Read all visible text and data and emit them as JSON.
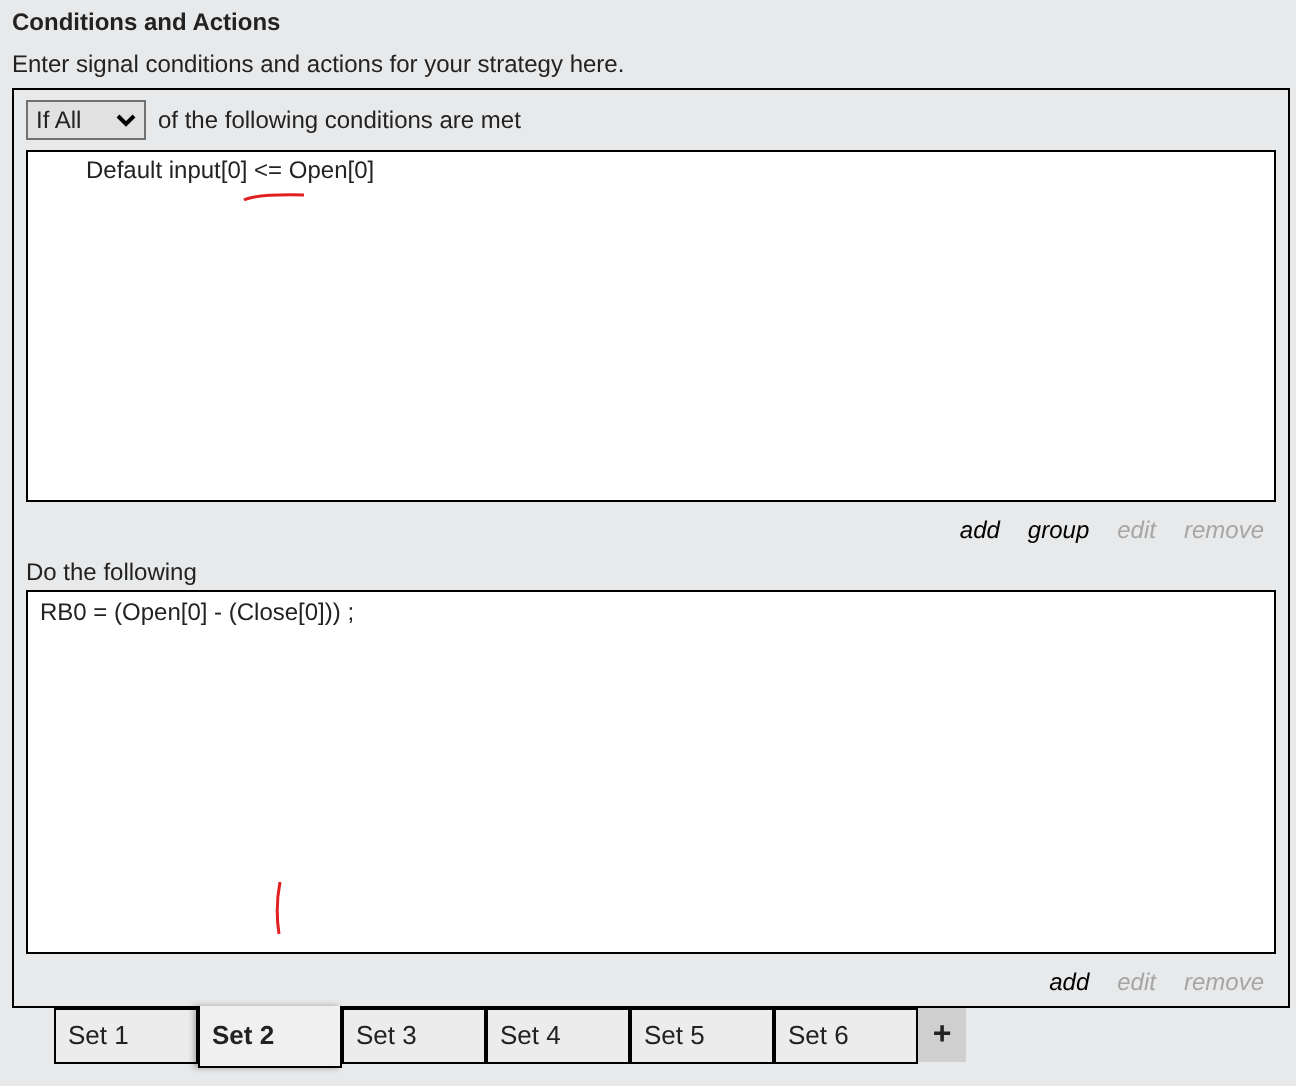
{
  "header": {
    "title": "Conditions and Actions",
    "subtitle": "Enter signal conditions and actions for your strategy here."
  },
  "condition_mode": {
    "value": "If All"
  },
  "conditions_label": "of the following conditions are met",
  "conditions": [
    {
      "text": "Default input[0] <= Open[0]"
    }
  ],
  "condition_links": [
    {
      "label": "add",
      "disabled": false
    },
    {
      "label": "group",
      "disabled": false
    },
    {
      "label": "edit",
      "disabled": true
    },
    {
      "label": "remove",
      "disabled": true
    }
  ],
  "actions_label": "Do the following",
  "actions": [
    {
      "text": "RB0 = (Open[0] - (Close[0])) ;"
    }
  ],
  "action_links": [
    {
      "label": "add",
      "disabled": false
    },
    {
      "label": "edit",
      "disabled": true
    },
    {
      "label": "remove",
      "disabled": true
    }
  ],
  "tabs": [
    {
      "label": "Set 1",
      "selected": false
    },
    {
      "label": "Set 2",
      "selected": true
    },
    {
      "label": "Set 3",
      "selected": false
    },
    {
      "label": "Set 4",
      "selected": false
    },
    {
      "label": "Set 5",
      "selected": false
    },
    {
      "label": "Set 6",
      "selected": false
    }
  ],
  "add_tab": {
    "label": "+"
  }
}
